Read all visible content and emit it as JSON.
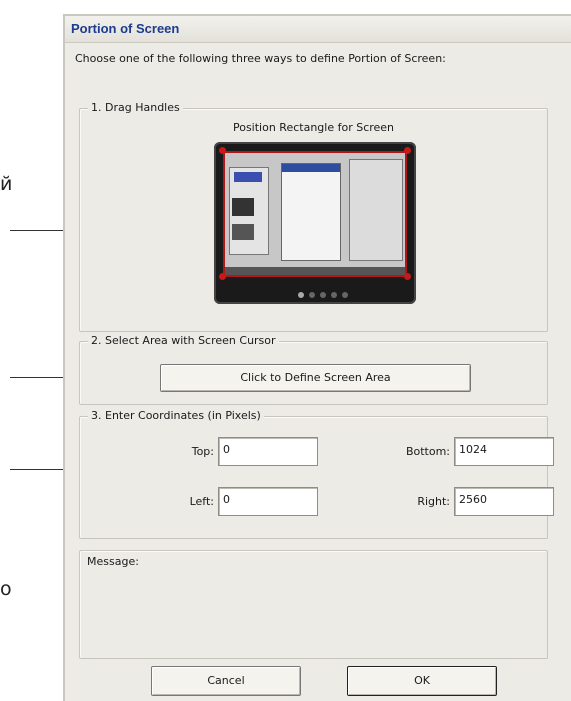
{
  "side_fragments": {
    "frag1": "й",
    "frag2": "о"
  },
  "dialog": {
    "title": "Portion of Screen",
    "intro": "Choose one of the following three ways to define Portion of Screen:",
    "group1": {
      "legend": "1. Drag Handles",
      "preview_caption": "Position Rectangle for Screen",
      "active_dot": 1
    },
    "group2": {
      "legend": "2. Select Area with Screen Cursor",
      "button_label": "Click to Define Screen Area"
    },
    "group3": {
      "legend": "3. Enter Coordinates (in Pixels)",
      "top_label": "Top:",
      "top_value": "0",
      "bottom_label": "Bottom:",
      "bottom_value": "1024",
      "left_label": "Left:",
      "left_value": "0",
      "right_label": "Right:",
      "right_value": "2560"
    },
    "message_label": "Message:",
    "cancel_label": "Cancel",
    "ok_label": "OK"
  },
  "colors": {
    "title_text": "#1d3b8f",
    "handle": "#c81818",
    "dialog_bg": "#ecebe6"
  }
}
